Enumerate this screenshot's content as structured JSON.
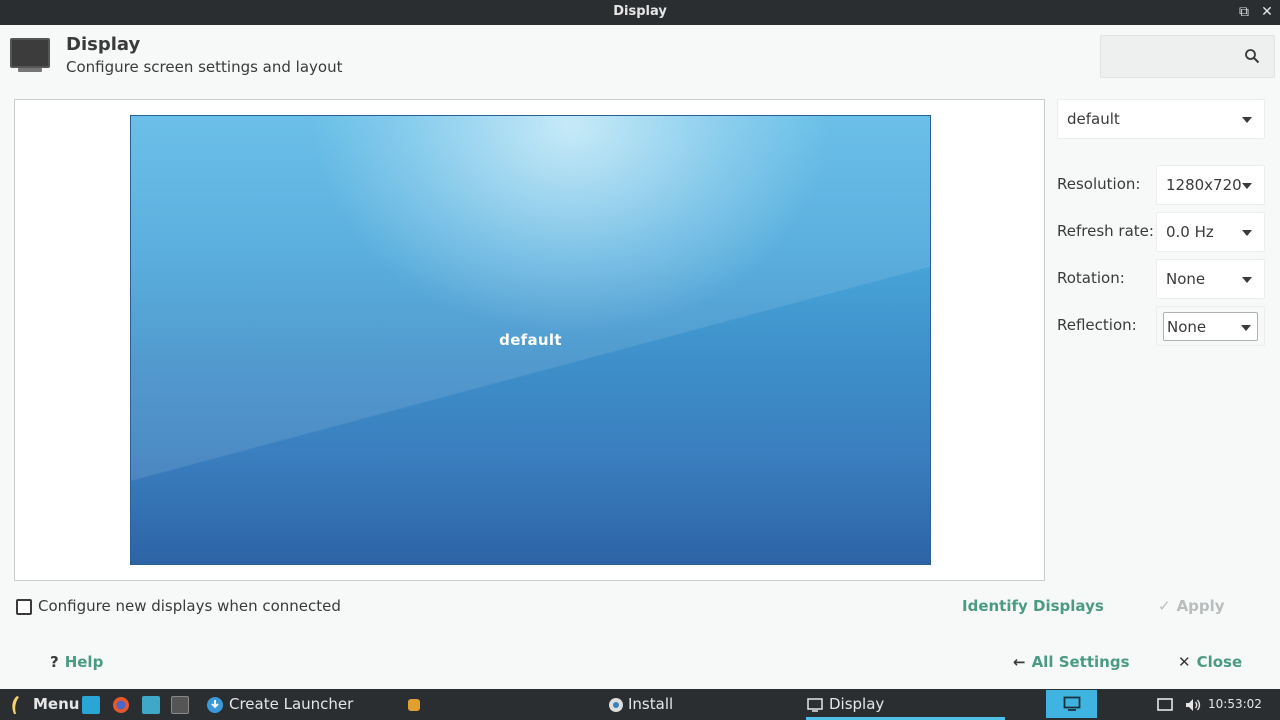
{
  "window": {
    "title": "Display",
    "restore_glyph": "⧉",
    "close_glyph": "✕"
  },
  "header": {
    "title": "Display",
    "subtitle": "Configure screen settings and layout",
    "search_placeholder": ""
  },
  "preview": {
    "monitor_label": "default"
  },
  "panel": {
    "output_selected": "default",
    "rows": [
      {
        "label": "Resolution:",
        "value": "1280x720"
      },
      {
        "label": "Refresh rate:",
        "value": "0.0 Hz"
      },
      {
        "label": "Rotation:",
        "value": "None"
      },
      {
        "label": "Reflection:",
        "value": "None"
      }
    ]
  },
  "bottom": {
    "configure_new_label": "Configure new displays when connected",
    "configure_new_checked": false,
    "identify_label": "Identify Displays",
    "apply_icon": "✓",
    "apply_label": "Apply",
    "help_icon": "?",
    "help_label": "Help",
    "all_settings_icon": "←",
    "all_settings_label": "All Settings",
    "close_icon": "✕",
    "close_label": "Close"
  },
  "taskbar": {
    "menu_label": "Menu",
    "tasks": [
      {
        "label": "Create Launcher",
        "icon": "download-icon"
      },
      {
        "label": "Install",
        "icon": "installer-icon"
      },
      {
        "label": "Display",
        "icon": "display-icon",
        "active": true
      }
    ],
    "clock": "10:53:02 am"
  },
  "colors": {
    "titlebar": "#2b2e31",
    "accent_link": "#4b9b84",
    "taskbar_active": "#4fc1e9"
  }
}
